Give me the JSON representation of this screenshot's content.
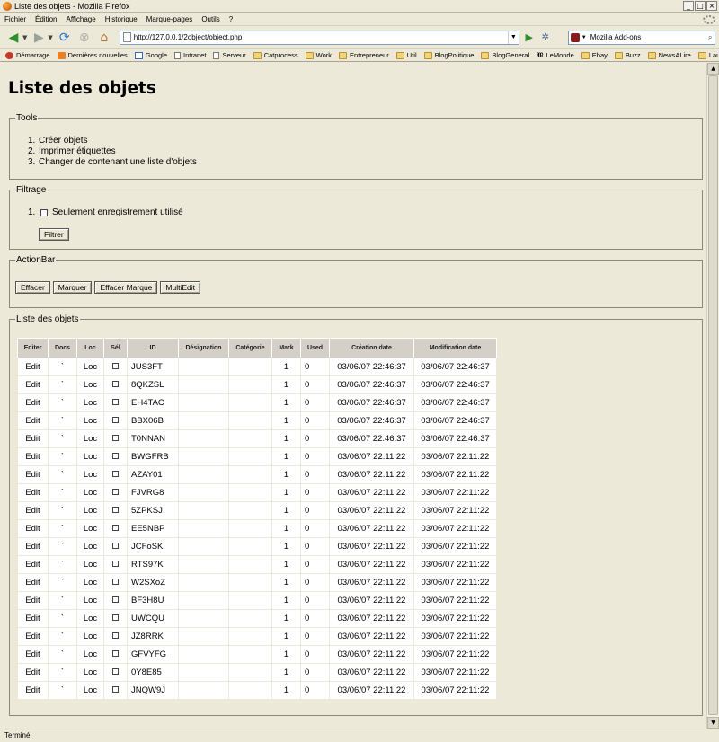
{
  "window": {
    "title": "Liste des objets - Mozilla Firefox"
  },
  "menu": [
    "Fichier",
    "Édition",
    "Affichage",
    "Historique",
    "Marque-pages",
    "Outils",
    "?"
  ],
  "navbar": {
    "url": "http://127.0.0.1/2object/object.php",
    "search_value": "Mozilla Add-ons"
  },
  "bookmarks": [
    {
      "label": "Démarrage",
      "icon": "fav-red"
    },
    {
      "label": "Dernières nouvelles",
      "icon": "fav-rss"
    },
    {
      "label": "Google",
      "icon": "fav-g"
    },
    {
      "label": "Intranet",
      "icon": "fav-page"
    },
    {
      "label": "Serveur",
      "icon": "fav-page"
    },
    {
      "label": "Catprocess",
      "icon": "folder"
    },
    {
      "label": "Work",
      "icon": "folder"
    },
    {
      "label": "Entrepreneur",
      "icon": "folder"
    },
    {
      "label": "Util",
      "icon": "folder"
    },
    {
      "label": "BlogPolitique",
      "icon": "folder"
    },
    {
      "label": "BlogGeneral",
      "icon": "folder"
    },
    {
      "label": "LeMonde",
      "icon": "fav-lm"
    },
    {
      "label": "Ebay",
      "icon": "folder"
    },
    {
      "label": "Buzz",
      "icon": "folder"
    },
    {
      "label": "NewsALire",
      "icon": "folder"
    },
    {
      "label": "Laurent",
      "icon": "folder"
    }
  ],
  "page": {
    "title": "Liste des objets",
    "tools": {
      "legend": "Tools",
      "items": [
        "Créer objets",
        "Imprimer étiquettes",
        "Changer de contenant une liste d'objets"
      ]
    },
    "filtrage": {
      "legend": "Filtrage",
      "option": "Seulement enregistrement utilisé",
      "button": "Filtrer"
    },
    "actionbar": {
      "legend": "ActionBar",
      "buttons": [
        "Effacer",
        "Marquer",
        "Effacer Marque",
        "MultiEdit"
      ]
    },
    "liste": {
      "legend": "Liste des objets",
      "columns": [
        "Editer",
        "Docs",
        "Loc",
        "Sél",
        "ID",
        "Désignation",
        "Catégorie",
        "Mark",
        "Used",
        "Création date",
        "Modification date"
      ],
      "rows": [
        {
          "edit": "Edit",
          "docs": "`",
          "loc": "Loc",
          "id": "JUS3FT",
          "mark": "1",
          "used": "0",
          "cdate": "03/06/07 22:46:37",
          "mdate": "03/06/07 22:46:37"
        },
        {
          "edit": "Edit",
          "docs": "`",
          "loc": "Loc",
          "id": "8QKZSL",
          "mark": "1",
          "used": "0",
          "cdate": "03/06/07 22:46:37",
          "mdate": "03/06/07 22:46:37"
        },
        {
          "edit": "Edit",
          "docs": "`",
          "loc": "Loc",
          "id": "EH4TAC",
          "mark": "1",
          "used": "0",
          "cdate": "03/06/07 22:46:37",
          "mdate": "03/06/07 22:46:37"
        },
        {
          "edit": "Edit",
          "docs": "`",
          "loc": "Loc",
          "id": "BBX06B",
          "mark": "1",
          "used": "0",
          "cdate": "03/06/07 22:46:37",
          "mdate": "03/06/07 22:46:37"
        },
        {
          "edit": "Edit",
          "docs": "`",
          "loc": "Loc",
          "id": "T0NNAN",
          "mark": "1",
          "used": "0",
          "cdate": "03/06/07 22:46:37",
          "mdate": "03/06/07 22:46:37"
        },
        {
          "edit": "Edit",
          "docs": "`",
          "loc": "Loc",
          "id": "BWGFRB",
          "mark": "1",
          "used": "0",
          "cdate": "03/06/07 22:11:22",
          "mdate": "03/06/07 22:11:22"
        },
        {
          "edit": "Edit",
          "docs": "`",
          "loc": "Loc",
          "id": "AZAY01",
          "mark": "1",
          "used": "0",
          "cdate": "03/06/07 22:11:22",
          "mdate": "03/06/07 22:11:22"
        },
        {
          "edit": "Edit",
          "docs": "`",
          "loc": "Loc",
          "id": "FJVRG8",
          "mark": "1",
          "used": "0",
          "cdate": "03/06/07 22:11:22",
          "mdate": "03/06/07 22:11:22"
        },
        {
          "edit": "Edit",
          "docs": "`",
          "loc": "Loc",
          "id": "5ZPKSJ",
          "mark": "1",
          "used": "0",
          "cdate": "03/06/07 22:11:22",
          "mdate": "03/06/07 22:11:22"
        },
        {
          "edit": "Edit",
          "docs": "`",
          "loc": "Loc",
          "id": "EE5NBP",
          "mark": "1",
          "used": "0",
          "cdate": "03/06/07 22:11:22",
          "mdate": "03/06/07 22:11:22"
        },
        {
          "edit": "Edit",
          "docs": "`",
          "loc": "Loc",
          "id": "JCFoSK",
          "mark": "1",
          "used": "0",
          "cdate": "03/06/07 22:11:22",
          "mdate": "03/06/07 22:11:22"
        },
        {
          "edit": "Edit",
          "docs": "`",
          "loc": "Loc",
          "id": "RTS97K",
          "mark": "1",
          "used": "0",
          "cdate": "03/06/07 22:11:22",
          "mdate": "03/06/07 22:11:22"
        },
        {
          "edit": "Edit",
          "docs": "`",
          "loc": "Loc",
          "id": "W2SXoZ",
          "mark": "1",
          "used": "0",
          "cdate": "03/06/07 22:11:22",
          "mdate": "03/06/07 22:11:22"
        },
        {
          "edit": "Edit",
          "docs": "`",
          "loc": "Loc",
          "id": "BF3H8U",
          "mark": "1",
          "used": "0",
          "cdate": "03/06/07 22:11:22",
          "mdate": "03/06/07 22:11:22"
        },
        {
          "edit": "Edit",
          "docs": "`",
          "loc": "Loc",
          "id": "UWCQU",
          "mark": "1",
          "used": "0",
          "cdate": "03/06/07 22:11:22",
          "mdate": "03/06/07 22:11:22"
        },
        {
          "edit": "Edit",
          "docs": "`",
          "loc": "Loc",
          "id": "JZ8RRK",
          "mark": "1",
          "used": "0",
          "cdate": "03/06/07 22:11:22",
          "mdate": "03/06/07 22:11:22"
        },
        {
          "edit": "Edit",
          "docs": "`",
          "loc": "Loc",
          "id": "GFVYFG",
          "mark": "1",
          "used": "0",
          "cdate": "03/06/07 22:11:22",
          "mdate": "03/06/07 22:11:22"
        },
        {
          "edit": "Edit",
          "docs": "`",
          "loc": "Loc",
          "id": "0Y8E85",
          "mark": "1",
          "used": "0",
          "cdate": "03/06/07 22:11:22",
          "mdate": "03/06/07 22:11:22"
        },
        {
          "edit": "Edit",
          "docs": "`",
          "loc": "Loc",
          "id": "JNQW9J",
          "mark": "1",
          "used": "0",
          "cdate": "03/06/07 22:11:22",
          "mdate": "03/06/07 22:11:22"
        }
      ]
    }
  },
  "status": {
    "text": "Terminé"
  }
}
